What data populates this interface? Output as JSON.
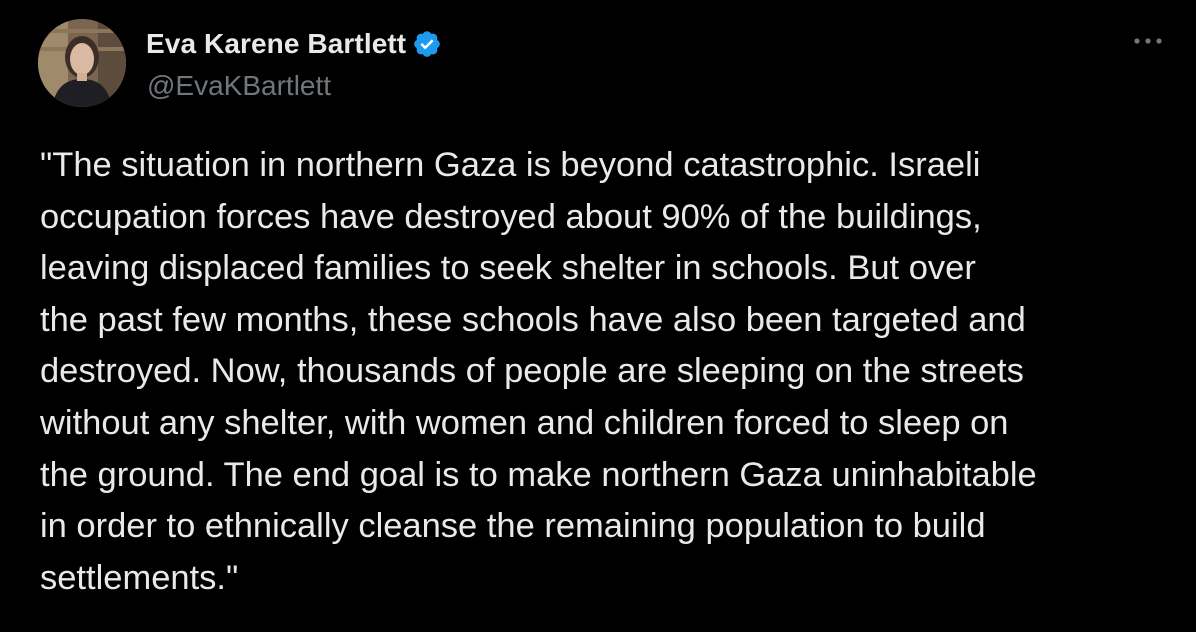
{
  "author": {
    "display_name": "Eva Karene Bartlett",
    "handle": "@EvaKBartlett",
    "verified_icon": "verified-badge-icon",
    "verified_color": "#1d9bf0"
  },
  "more_icon": "more-horizontal-icon",
  "tweet": {
    "lines": [
      "\"The situation in northern Gaza is beyond catastrophic. Israeli",
      "occupation forces have destroyed about 90% of the buildings,",
      "leaving displaced families to seek shelter in schools. But over",
      "the past few months, these schools have also been targeted and",
      "destroyed. Now, thousands of people are sleeping on the streets",
      "without any shelter, with women and children forced to sleep on",
      "the ground. The end goal is to make northern Gaza uninhabitable",
      "in order to ethnically cleanse the remaining population to build",
      "settlements.\""
    ]
  },
  "colors": {
    "background": "#000000",
    "primary_text": "#e7e9ea",
    "secondary_text": "#71767b"
  }
}
